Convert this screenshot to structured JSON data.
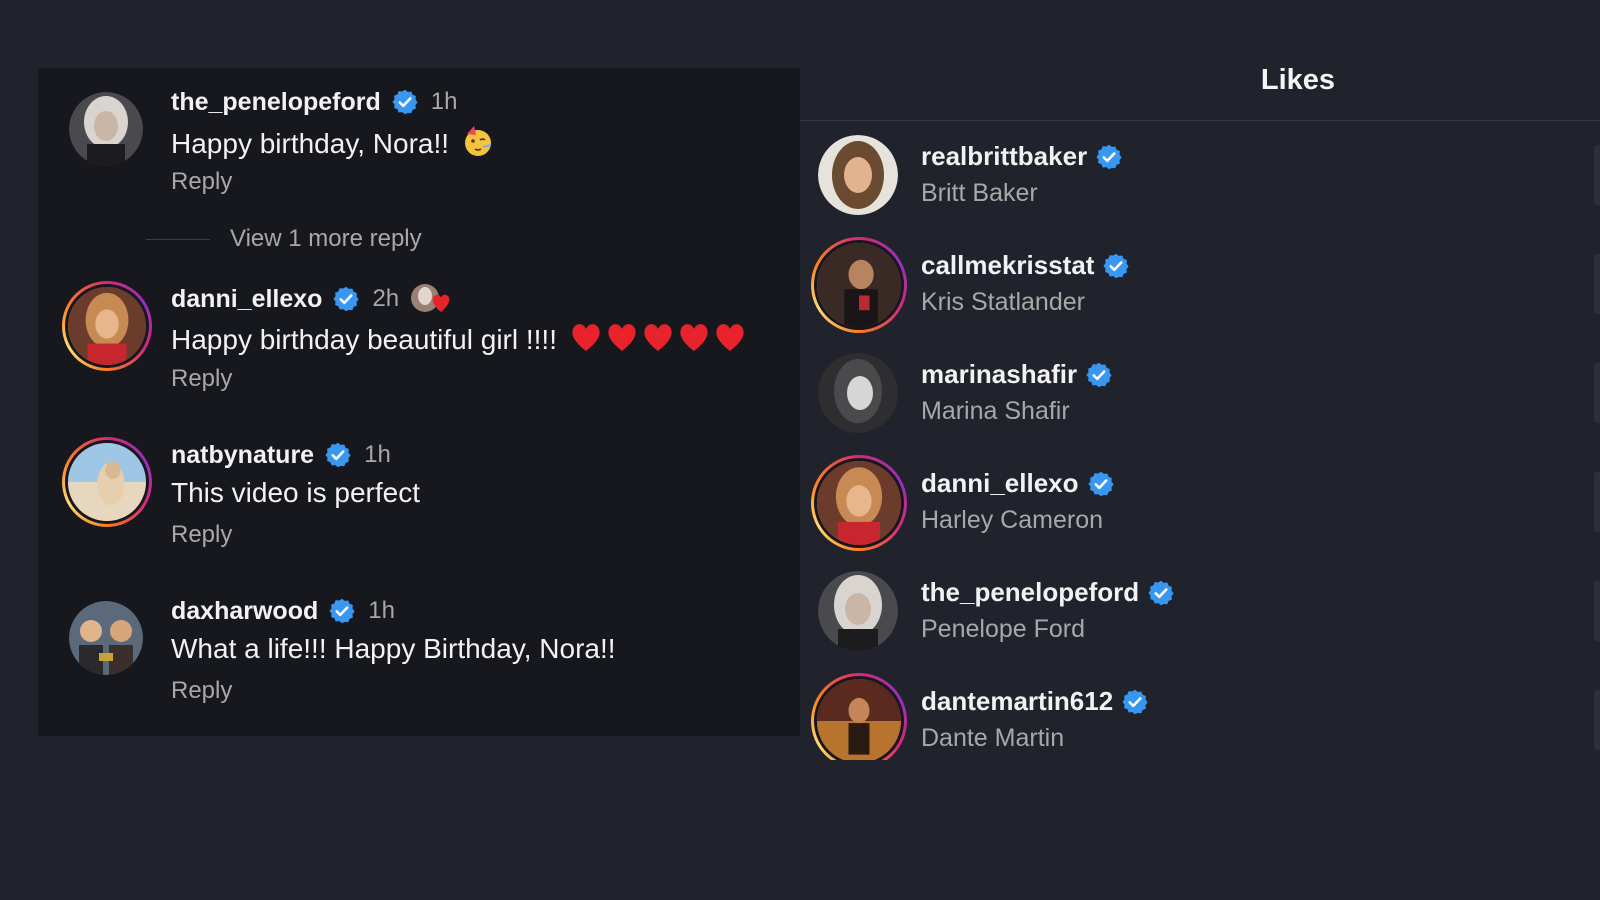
{
  "colors": {
    "background": "#20232b",
    "comments_panel": "#16181e",
    "verified": "#3897f0",
    "secondary_text": "#a8a8a8",
    "heart": "#e8232c"
  },
  "icons": {
    "verified": "verified-badge-icon",
    "party": "partying-face-emoji",
    "heart": "red-heart-emoji"
  },
  "comments": [
    {
      "username": "the_penelopeford",
      "time": "1h",
      "text": "Happy birthday, Nora!!",
      "reply_label": "Reply"
    },
    {
      "username": "danni_ellexo",
      "time": "2h",
      "text": "Happy birthday beautiful girl !!!!",
      "reply_label": "Reply"
    },
    {
      "username": "natbynature",
      "time": "1h",
      "text": "This video is perfect",
      "reply_label": "Reply"
    },
    {
      "username": "daxharwood",
      "time": "1h",
      "text": "What a life!!! Happy Birthday, Nora!!",
      "reply_label": "Reply"
    }
  ],
  "view_more_replies": "View 1 more reply",
  "likes": {
    "title": "Likes",
    "users": [
      {
        "username": "realbrittbaker",
        "name": "Britt Baker"
      },
      {
        "username": "callmekrisstat",
        "name": "Kris Statlander"
      },
      {
        "username": "marinashafir",
        "name": "Marina Shafir"
      },
      {
        "username": "danni_ellexo",
        "name": "Harley Cameron"
      },
      {
        "username": "the_penelopeford",
        "name": "Penelope Ford"
      },
      {
        "username": "dantemartin612",
        "name": "Dante Martin"
      }
    ]
  }
}
